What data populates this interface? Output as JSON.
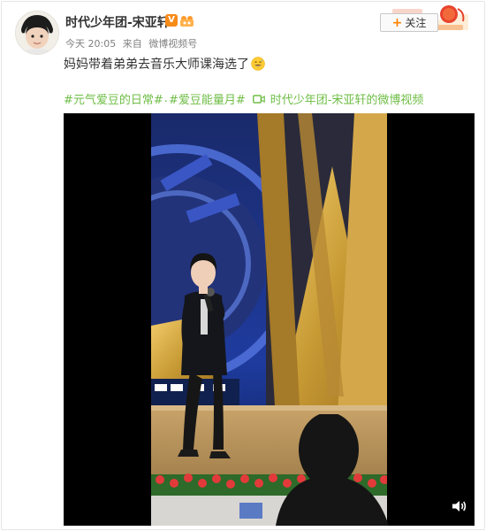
{
  "header": {
    "username": "时代少年团-宋亚轩",
    "vip_badge": "V",
    "time": "今天 20:05",
    "source_prefix": "来自",
    "source": "微博视频号"
  },
  "follow": {
    "label": "关注",
    "icon": "plus-icon"
  },
  "post": {
    "text": "妈妈带着弟弟去音乐大师课海选了",
    "emoji": "grinning-sweat-emoji"
  },
  "topics": {
    "items": [
      "#元气爱豆的日常#",
      "#爱豆能量月#"
    ],
    "separator": ".",
    "video_link_label": "时代少年团-宋亚轩的微博视频",
    "video_icon": "video-camera-icon"
  },
  "video": {
    "mute_icon": "volume-icon"
  },
  "colors": {
    "accent_green": "#6ebd45",
    "follow_orange": "#ff8200",
    "vip_orange": "#f78b18",
    "text_primary": "#333333",
    "text_meta": "#808080"
  }
}
